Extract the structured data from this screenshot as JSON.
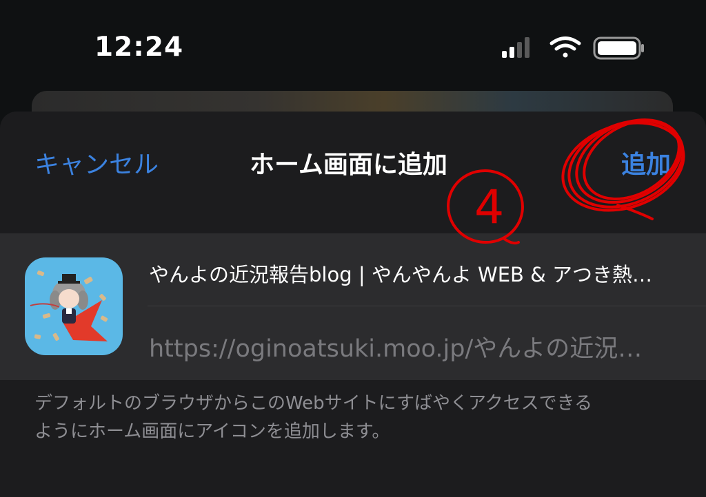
{
  "status_bar": {
    "time": "12:24"
  },
  "dialog": {
    "cancel_label": "キャンセル",
    "title": "ホーム画面に追加",
    "add_label": "追加"
  },
  "bookmark": {
    "title": "やんよの近況報告blog | やんやんよ WEB & アつき熱…",
    "url": "https://oginoatsuki.moo.jp/やんよの近況…"
  },
  "description": {
    "line1": "デフォルトのブラウザからこのWebサイトにすばやくアクセスできる",
    "line2": "ようにホーム画面にアイコンを追加します。"
  },
  "annotation": {
    "step_number": "4",
    "color": "#e00000"
  },
  "colors": {
    "accent": "#3b82e0",
    "sheet": "#1c1c1e",
    "field": "#2c2c2e"
  }
}
